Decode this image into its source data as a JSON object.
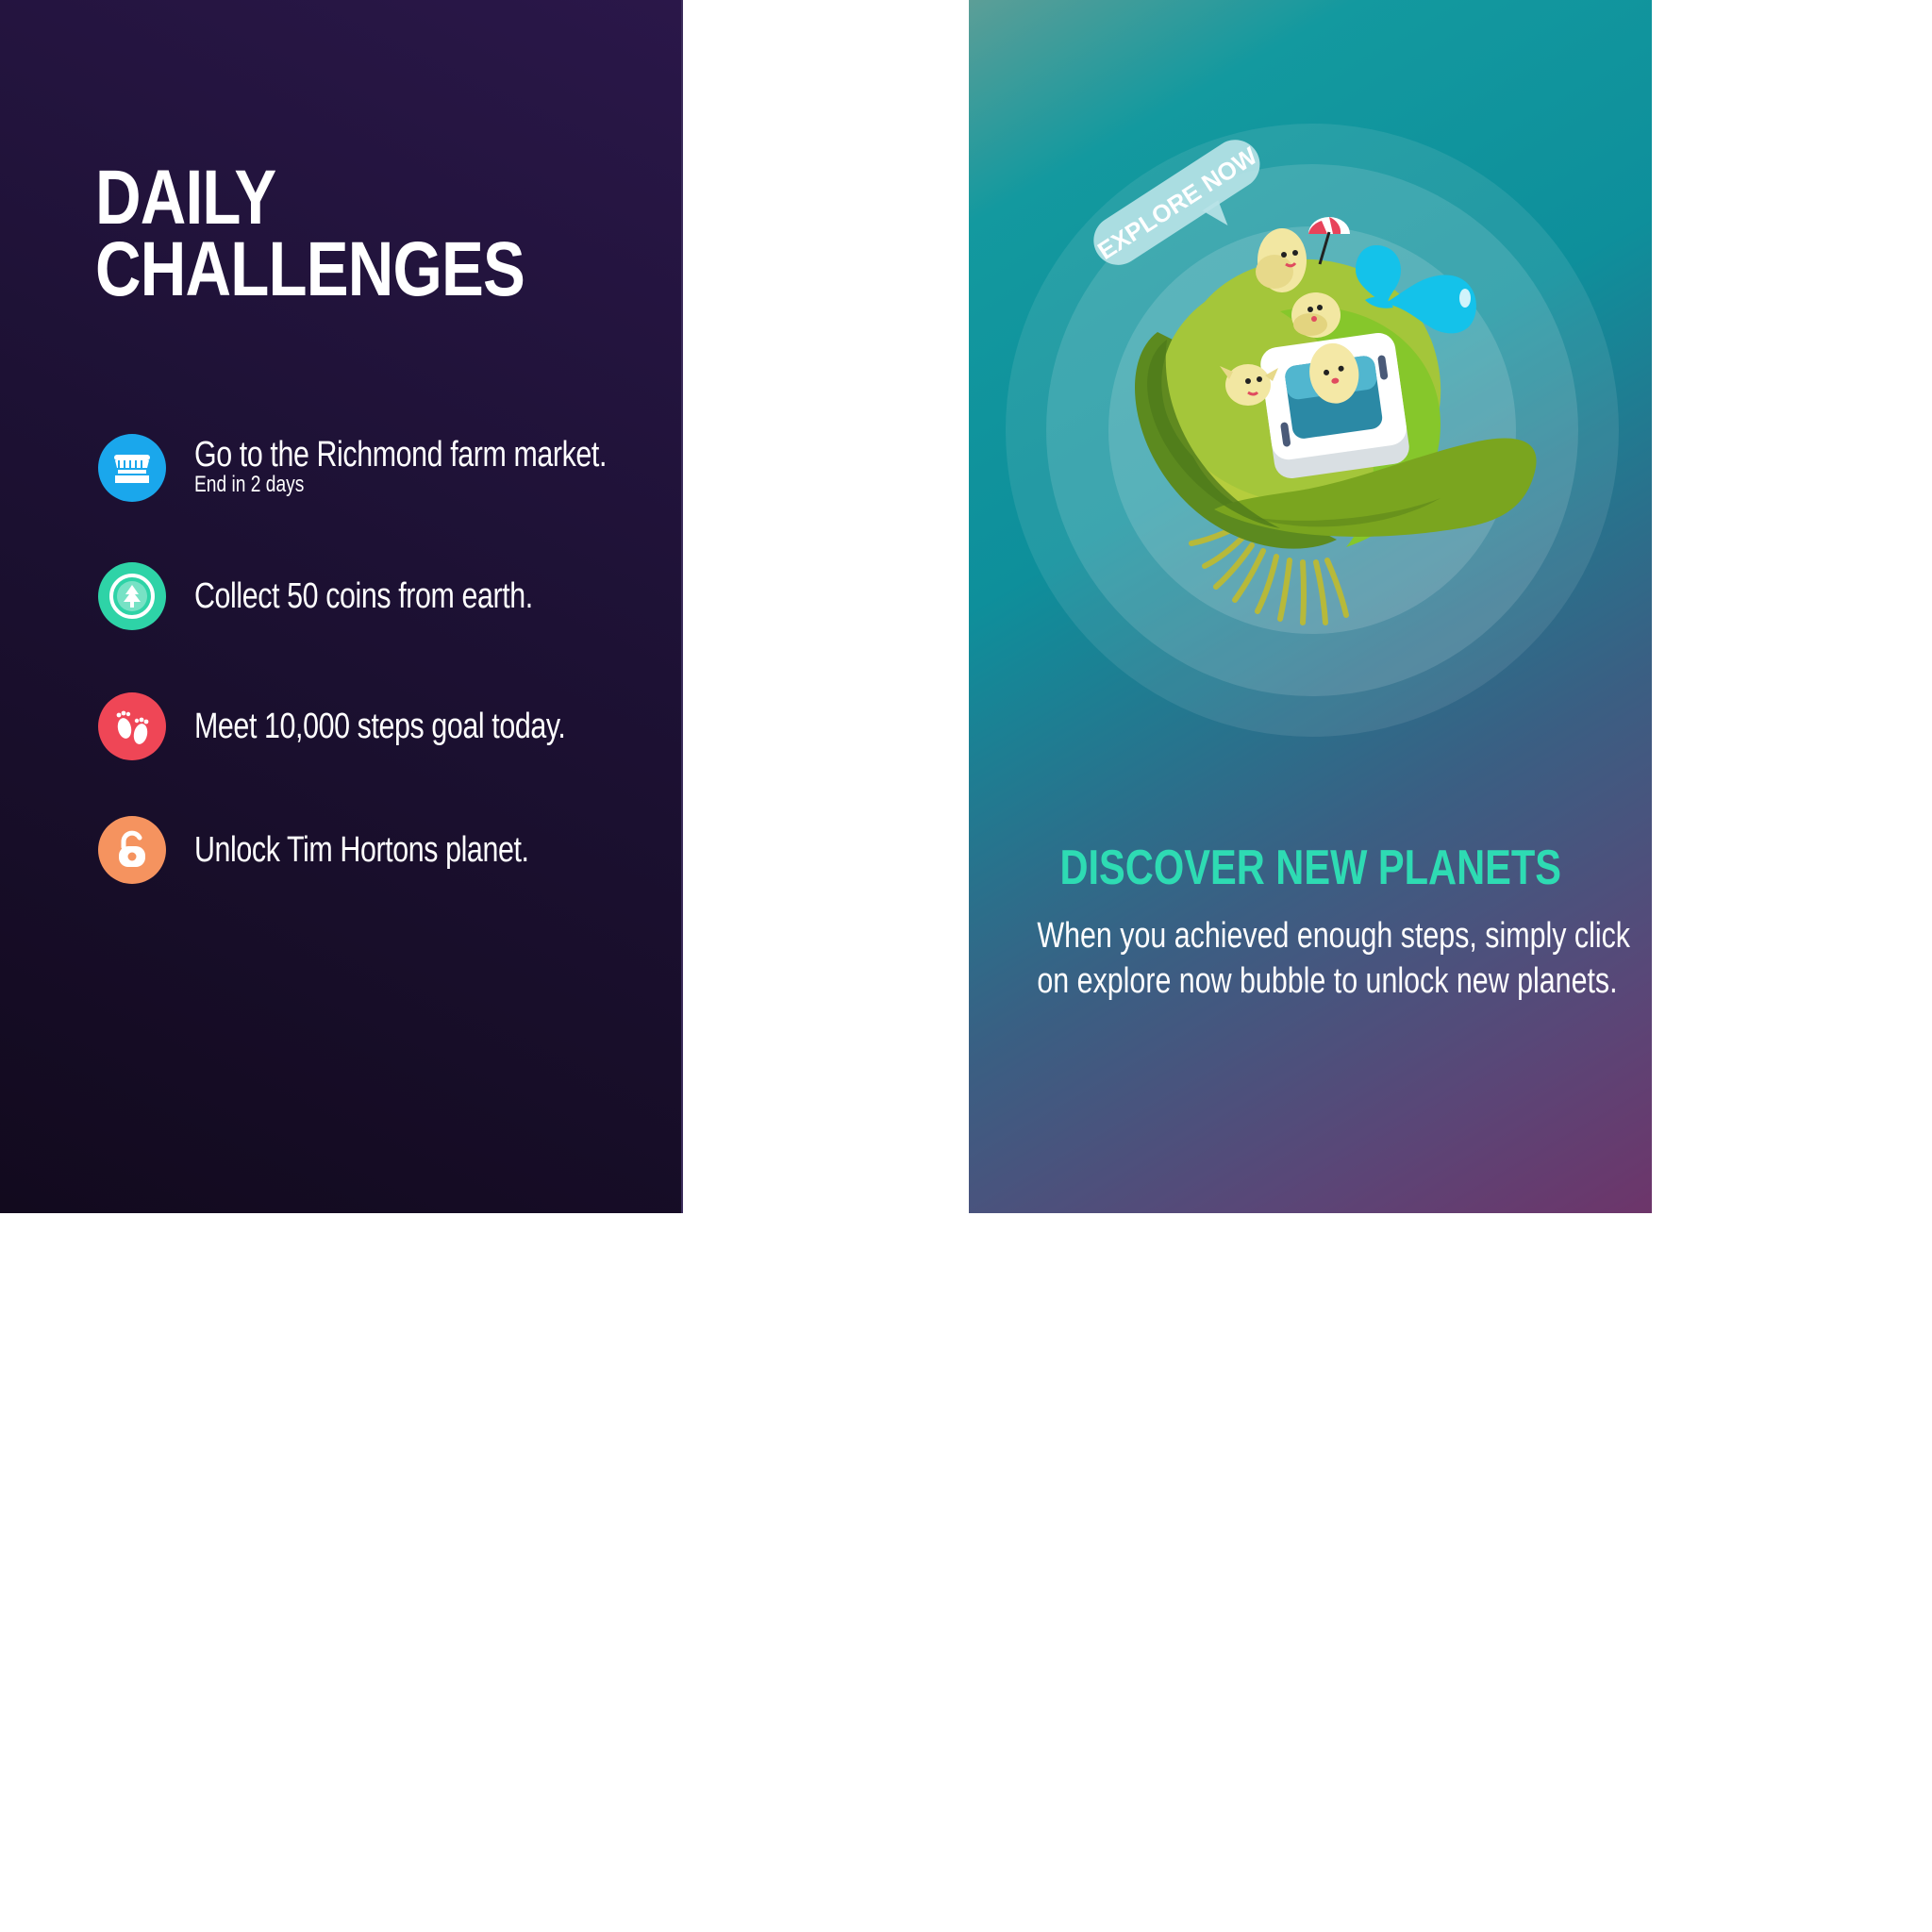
{
  "daily_challenges": {
    "title_line1": "DAILY",
    "title_line2": "CHALLENGES",
    "items": [
      {
        "label": "Go to the Richmond farm market.",
        "sublabel": "End in 2 days",
        "icon": "store-icon",
        "color": "#1aa7ec"
      },
      {
        "label": "Collect 50 coins from earth.",
        "icon": "coin-tree-icon",
        "color": "#2ed3a7"
      },
      {
        "label": "Meet 10,000 steps goal today.",
        "icon": "footprints-icon",
        "color": "#ef4656"
      },
      {
        "label": "Unlock Tim Hortons planet.",
        "icon": "unlock-icon",
        "color": "#f5935f"
      }
    ]
  },
  "discover": {
    "bubble_label": "EXPLORE NOW",
    "title": "DISCOVER NEW PLANETS",
    "body_line1": "When you achieved enough steps, simply click",
    "body_line2": "on explore now bubble to unlock new planets.",
    "accent_color": "#2edbb3"
  },
  "colors": {
    "left_bg": "#1d1134",
    "right_bg_start": "#13999f",
    "right_bg_end": "#6d356a",
    "planet_green": "#9ccf35"
  }
}
